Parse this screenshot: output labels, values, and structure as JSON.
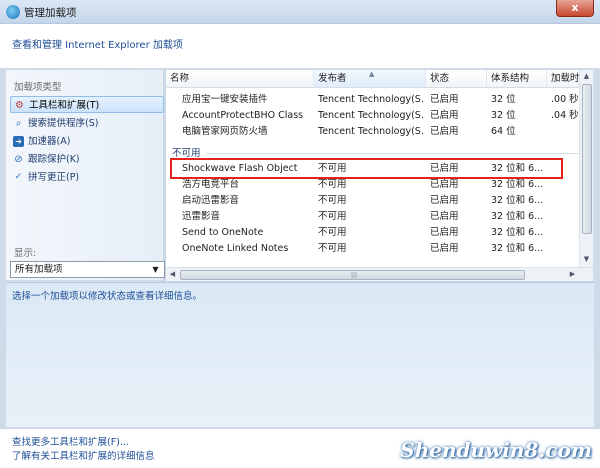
{
  "window": {
    "title": "管理加载项",
    "close_label": "x"
  },
  "header": {
    "text": "查看和管理 Internet Explorer 加载项"
  },
  "sidebar": {
    "group_label": "加载项类型",
    "items": [
      {
        "label": "工具栏和扩展(T)",
        "icon": "toolbar-icon"
      },
      {
        "label": "搜索提供程序(S)",
        "icon": "search-icon"
      },
      {
        "label": "加速器(A)",
        "icon": "accelerator-icon"
      },
      {
        "label": "跟踪保护(K)",
        "icon": "block-icon"
      },
      {
        "label": "拼写更正(P)",
        "icon": "spellcheck-icon"
      }
    ],
    "show_label": "显示:",
    "show_value": "所有加载项"
  },
  "table": {
    "columns": [
      "名称",
      "发布者",
      "状态",
      "体系结构",
      "加载时"
    ],
    "rows_top": [
      [
        "应用宝一键安装插件",
        "Tencent Technology(S...",
        "已启用",
        "32 位",
        ".00 秒"
      ],
      [
        "AccountProtectBHO Class",
        "Tencent Technology(S...",
        "已启用",
        "32 位",
        ".04 秒"
      ],
      [
        "电脑管家网页防火墙",
        "Tencent Technology(S...",
        "已启用",
        "64 位",
        ""
      ]
    ],
    "group_label": "不可用",
    "rows_group": [
      [
        "Shockwave Flash Object",
        "不可用",
        "已启用",
        "32 位和 6...",
        ""
      ],
      [
        "浩方电竞平台",
        "不可用",
        "已启用",
        "32 位和 6...",
        ""
      ],
      [
        "启动迅雷影音",
        "不可用",
        "已启用",
        "32 位和 6...",
        ""
      ],
      [
        "迅雷影音",
        "不可用",
        "已启用",
        "32 位和 6...",
        ""
      ],
      [
        "Send to OneNote",
        "不可用",
        "已启用",
        "32 位和 6...",
        ""
      ],
      [
        "OneNote Linked Notes",
        "不可用",
        "已启用",
        "32 位和 6...",
        ""
      ]
    ]
  },
  "detail": {
    "text": "选择一个加载项以修改状态或查看详细信息。"
  },
  "footer": {
    "link1": "查找更多工具栏和扩展(F)...",
    "link2": "了解有关工具栏和扩展的详细信息"
  },
  "watermark": "Shenduwin8.com"
}
